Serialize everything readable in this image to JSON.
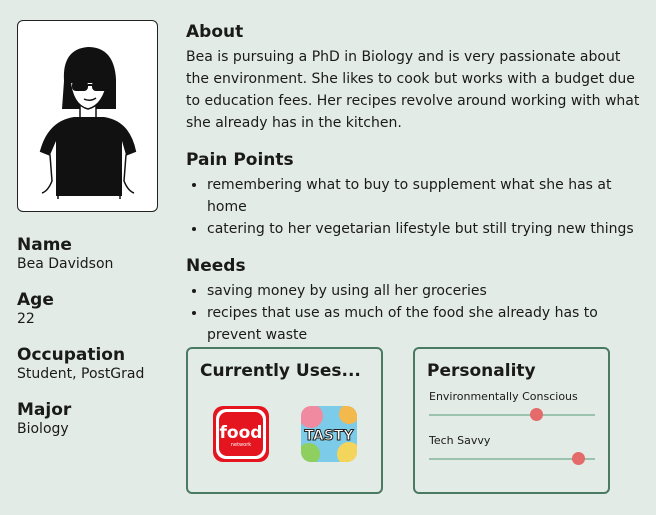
{
  "profile": {
    "name_label": "Name",
    "name": "Bea Davidson",
    "age_label": "Age",
    "age": "22",
    "occupation_label": "Occupation",
    "occupation": "Student, PostGrad",
    "major_label": "Major",
    "major": "Biology"
  },
  "about": {
    "title": "About",
    "text": "Bea is pursuing a PhD in Biology and is very passionate about the environment. She likes to cook but works with a budget due to education fees. Her recipes revolve around working with what she already has in the kitchen."
  },
  "pain_points": {
    "title": "Pain Points",
    "items": [
      "remembering what to buy to supplement what she has at home",
      "catering to her vegetarian lifestyle but still trying new things"
    ]
  },
  "needs": {
    "title": "Needs",
    "items": [
      "saving money by using all her groceries",
      "recipes that use as much of the food she already has to prevent waste"
    ]
  },
  "uses": {
    "title": "Currently Uses...",
    "apps": [
      {
        "icon": "food-network-logo",
        "word": "food",
        "sub": "network",
        "color": "#e4151f"
      },
      {
        "icon": "tasty-logo",
        "word": "TASTY"
      }
    ]
  },
  "personality": {
    "title": "Personality",
    "traits": [
      {
        "label": "Environmentally Conscious",
        "level": 0.65
      },
      {
        "label": "Tech Savvy",
        "level": 0.9
      }
    ]
  },
  "colors": {
    "background": "#e3ebe6",
    "border": "#4a7a62",
    "slider_track": "#9bc2ad",
    "slider_thumb": "#e56a6a"
  }
}
